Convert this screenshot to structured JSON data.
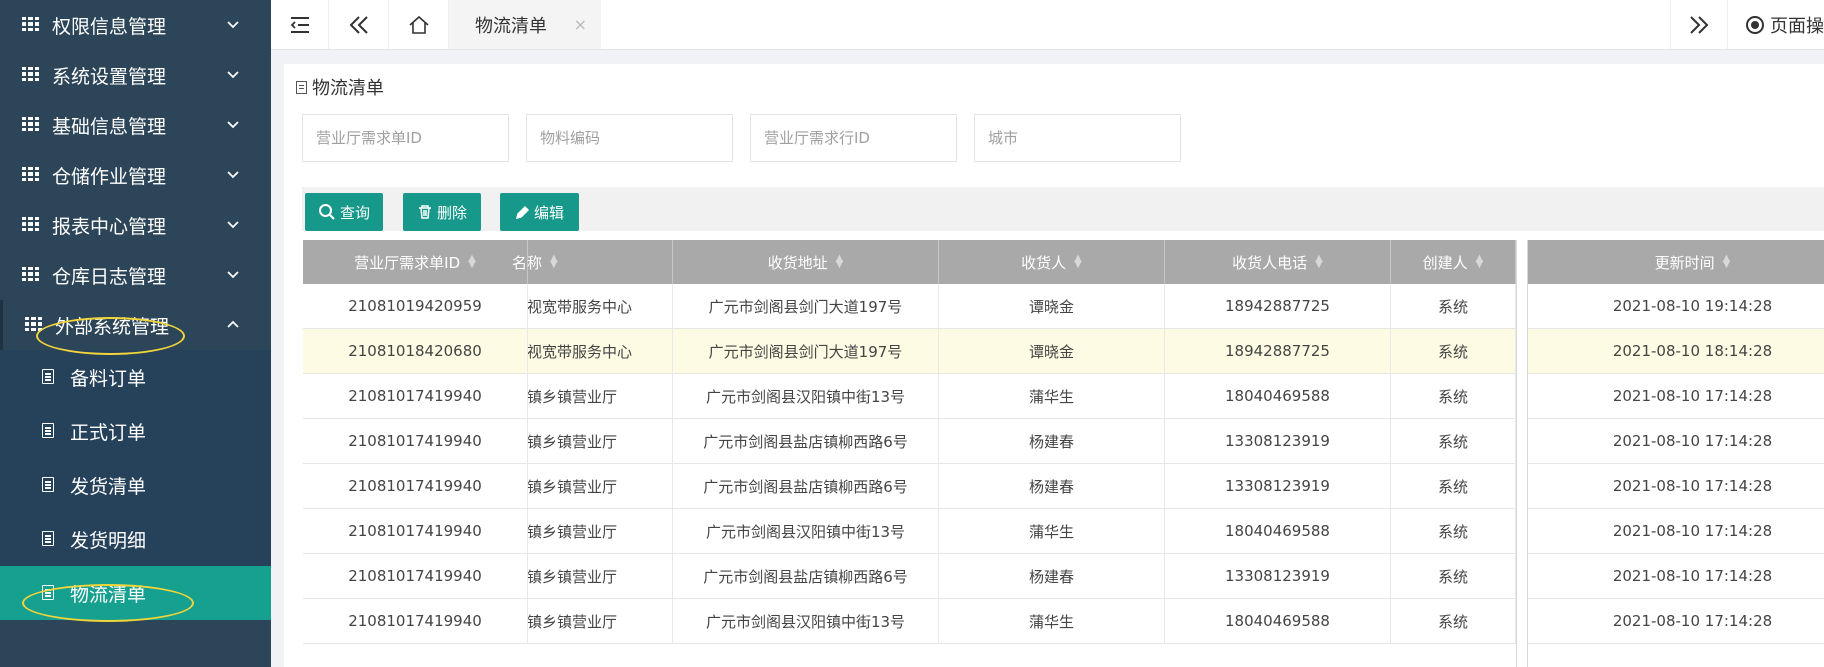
{
  "sidebar": {
    "groups": [
      {
        "label": "权限信息管理"
      },
      {
        "label": "系统设置管理"
      },
      {
        "label": "基础信息管理"
      },
      {
        "label": "仓储作业管理"
      },
      {
        "label": "报表中心管理"
      },
      {
        "label": "仓库日志管理"
      },
      {
        "label": "外部系统管理"
      }
    ],
    "sub_items": [
      {
        "label": "备料订单"
      },
      {
        "label": "正式订单"
      },
      {
        "label": "发货清单"
      },
      {
        "label": "发货明细"
      },
      {
        "label": "物流清单"
      }
    ]
  },
  "topbar": {
    "tab_label": "物流清单",
    "tab_close": "×",
    "page_ops_label": "页面操"
  },
  "content": {
    "section_title": "物流清单",
    "filters": [
      {
        "placeholder": "营业厅需求单ID"
      },
      {
        "placeholder": "物料编码"
      },
      {
        "placeholder": "营业厅需求行ID"
      },
      {
        "placeholder": "城市"
      }
    ],
    "buttons": {
      "query": "查询",
      "delete": "删除",
      "edit": "编辑"
    },
    "table": {
      "headers": [
        "营业厅需求单ID",
        "名称",
        "收货地址",
        "收货人",
        "收货人电话",
        "创建人",
        "更新时间"
      ],
      "rows": [
        [
          "21081019420959",
          "电视宽带服务中心",
          "广元市剑阁县剑门大道197号",
          "谭晓金",
          "18942887725",
          "系统",
          "2021-08-10 19:14:28"
        ],
        [
          "21081018420680",
          "电视宽带服务中心",
          "广元市剑阁县剑门大道197号",
          "谭晓金",
          "18942887725",
          "系统",
          "2021-08-10 18:14:28"
        ],
        [
          "21081017419940",
          "阳镇乡镇营业厅",
          "广元市剑阁县汉阳镇中街13号",
          "蒲华生",
          "18040469588",
          "系统",
          "2021-08-10 17:14:28"
        ],
        [
          "21081017419940",
          "店镇乡镇营业厅",
          "广元市剑阁县盐店镇柳西路6号",
          "杨建春",
          "13308123919",
          "系统",
          "2021-08-10 17:14:28"
        ],
        [
          "21081017419940",
          "店镇乡镇营业厅",
          "广元市剑阁县盐店镇柳西路6号",
          "杨建春",
          "13308123919",
          "系统",
          "2021-08-10 17:14:28"
        ],
        [
          "21081017419940",
          "阳镇乡镇营业厅",
          "广元市剑阁县汉阳镇中街13号",
          "蒲华生",
          "18040469588",
          "系统",
          "2021-08-10 17:14:28"
        ],
        [
          "21081017419940",
          "店镇乡镇营业厅",
          "广元市剑阁县盐店镇柳西路6号",
          "杨建春",
          "13308123919",
          "系统",
          "2021-08-10 17:14:28"
        ],
        [
          "21081017419940",
          "阳镇乡镇营业厅",
          "广元市剑阁县汉阳镇中街13号",
          "蒲华生",
          "18040469588",
          "系统",
          "2021-08-10 17:14:28"
        ]
      ],
      "highlighted_row": 1
    }
  },
  "colors": {
    "sidebar_bg": "#2c4558",
    "active_item": "#16a08f",
    "button": "#16998a",
    "header": "#a9a9a9",
    "highlight_row": "#fdfbe3",
    "annotation": "#f2d43b"
  }
}
